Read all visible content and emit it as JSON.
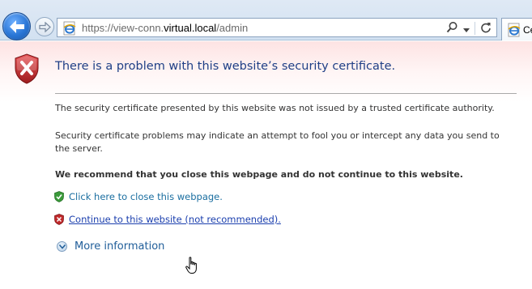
{
  "browser": {
    "url_prefix": "https://view-conn.",
    "url_host": "virtual.local",
    "url_suffix": "/admin",
    "tab_title": "Ce",
    "icons": {
      "back": "back-arrow-icon",
      "forward": "forward-arrow-icon",
      "page": "ie-page-icon",
      "search": "search-icon",
      "dropdown": "dropdown-arrow-icon",
      "refresh": "refresh-icon"
    }
  },
  "page": {
    "title": "There is a problem with this website’s security certificate.",
    "para1": "The security certificate presented by this website was not issued by a trusted certificate authority.",
    "para2": "Security certificate problems may indicate an attempt to fool you or intercept any data you send to the server.",
    "recommendation": "We recommend that you close this webpage and do not continue to this website.",
    "close_link": "Click here to close this webpage.",
    "continue_link": "Continue to this website (not recommended).",
    "more_info": "More information",
    "colors": {
      "title": "#1f3f86",
      "close_link": "#1a6ea0",
      "continue_link": "#1b3fae",
      "shield_red": "#c0292b",
      "shield_green": "#3a9a3a"
    }
  }
}
